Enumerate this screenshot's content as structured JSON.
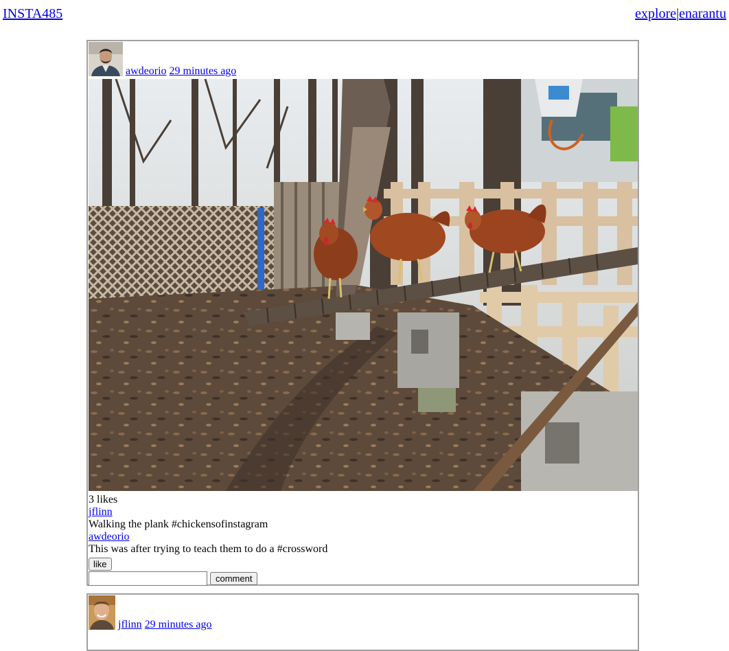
{
  "header": {
    "brand": "INSTA485",
    "nav_explore": "explore",
    "nav_separator": "|",
    "nav_user": "enarantu"
  },
  "posts": [
    {
      "owner": "awdeorio",
      "timestamp": "29 minutes ago",
      "likes_text": "3 likes",
      "comments": [
        {
          "owner": "jflinn ",
          "text": "Walking the plank #chickensofinstagram"
        },
        {
          "owner": "awdeorio ",
          "text": "This was after trying to teach them to do a #crossword"
        }
      ],
      "like_label": "like",
      "comment_placeholder": "",
      "comment_label": "comment"
    },
    {
      "owner": "jflinn",
      "timestamp": "29 minutes ago"
    }
  ],
  "colors": {
    "link": "#0000ee",
    "post_border": "#a0a0a0"
  }
}
